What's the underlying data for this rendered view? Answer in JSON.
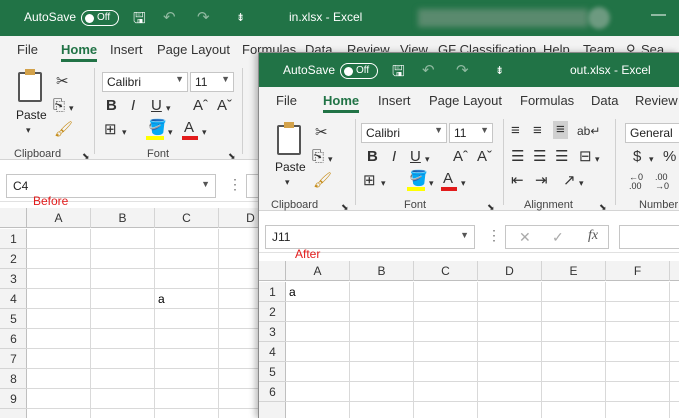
{
  "before": {
    "title": "in.xlsx  -  Excel",
    "autosave_label": "AutoSave",
    "toggle_label": "Off",
    "tabs": [
      "File",
      "Home",
      "Insert",
      "Page Layout",
      "Formulas",
      "Data",
      "Review",
      "View",
      "GF Classification",
      "Help",
      "Team",
      "Sea"
    ],
    "font_name": "Calibri",
    "font_size": "11",
    "paste_label": "Paste",
    "groups": {
      "clipboard": "Clipboard",
      "font": "Font"
    },
    "name_box": "C4",
    "caption": "Before",
    "columns": [
      "A",
      "B",
      "C",
      "D"
    ],
    "rows": [
      "1",
      "2",
      "3",
      "4",
      "5",
      "6",
      "7",
      "8",
      "9"
    ],
    "cell_c4": "a"
  },
  "after": {
    "title": "out.xlsx  -  Excel",
    "autosave_label": "AutoSave",
    "toggle_label": "Off",
    "tabs": [
      "File",
      "Home",
      "Insert",
      "Page Layout",
      "Formulas",
      "Data",
      "Review"
    ],
    "font_name": "Calibri",
    "font_size": "11",
    "number_format": "General",
    "paste_label": "Paste",
    "groups": {
      "clipboard": "Clipboard",
      "font": "Font",
      "alignment": "Alignment",
      "number": "Number"
    },
    "name_box": "J11",
    "caption": "After",
    "columns": [
      "A",
      "B",
      "C",
      "D",
      "E",
      "F"
    ],
    "rows": [
      "1",
      "2",
      "3",
      "4",
      "5",
      "6"
    ],
    "cell_a1": "a"
  },
  "colors": {
    "excel_green": "#217346",
    "caption_red": "#e21b1b",
    "font_color_bar": "#e21b1b",
    "highlight_bar": "#ffff00"
  },
  "icons": [
    "save-icon",
    "undo-icon",
    "redo-icon",
    "customize-qat-icon",
    "paste-icon",
    "cut-icon",
    "copy-icon",
    "format-painter-icon",
    "bold-icon",
    "italic-icon",
    "underline-icon",
    "grow-font-icon",
    "shrink-font-icon",
    "borders-icon",
    "fill-color-icon",
    "font-color-icon",
    "align-icon",
    "wrap-text-icon",
    "merge-icon",
    "orientation-icon",
    "currency-icon",
    "percent-icon",
    "dialog-launcher-icon"
  ]
}
